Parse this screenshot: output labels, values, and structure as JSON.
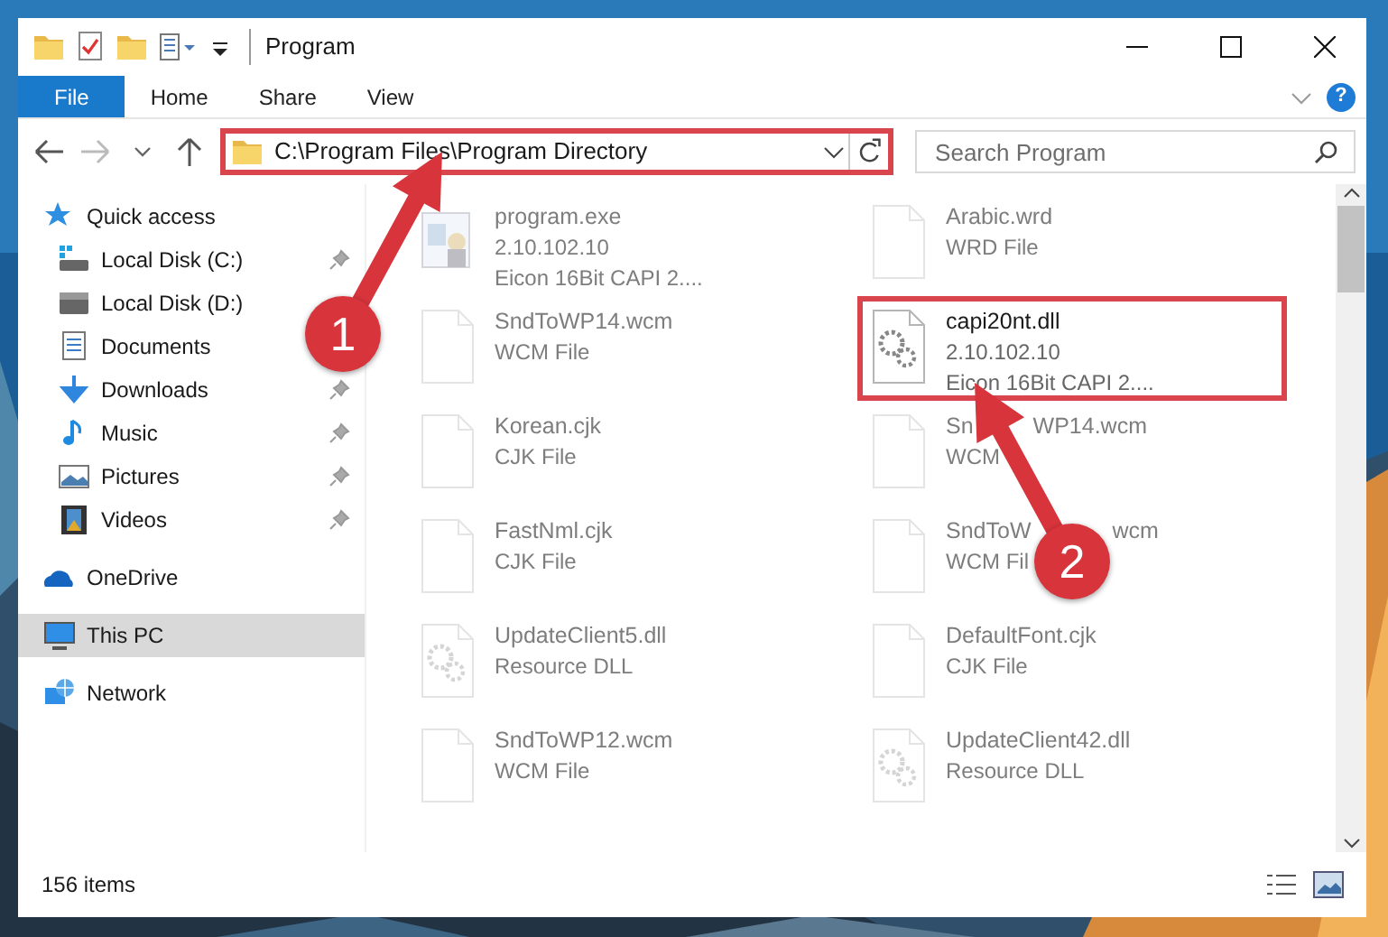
{
  "window": {
    "title": "Program"
  },
  "ribbon": {
    "tabs": [
      {
        "label": "File",
        "selected": true
      },
      {
        "label": "Home",
        "selected": false
      },
      {
        "label": "Share",
        "selected": false
      },
      {
        "label": "View",
        "selected": false
      }
    ],
    "help": "?"
  },
  "address_bar": {
    "path": "C:\\Program Files\\Program Directory",
    "highlighted": true
  },
  "search": {
    "placeholder": "Search Program"
  },
  "sidebar": {
    "items": [
      {
        "label": "Quick access",
        "selected": false,
        "children": [
          {
            "label": "Local Disk (C:)",
            "pinned": true,
            "selected": false
          },
          {
            "label": "Local Disk (D:)",
            "pinned": false,
            "selected": false
          },
          {
            "label": "Documents",
            "pinned": false,
            "selected": false
          },
          {
            "label": "Downloads",
            "pinned": true,
            "selected": false
          },
          {
            "label": "Music",
            "pinned": true,
            "selected": false
          },
          {
            "label": "Pictures",
            "pinned": true,
            "selected": false
          },
          {
            "label": "Videos",
            "pinned": true,
            "selected": false
          }
        ]
      },
      {
        "label": "OneDrive",
        "selected": false
      },
      {
        "label": "This PC",
        "selected": true
      },
      {
        "label": "Network",
        "selected": false
      }
    ]
  },
  "files": [
    {
      "name": "program.exe",
      "details": [
        "2.10.102.10",
        "Eicon 16Bit CAPI 2...."
      ],
      "kind": "program",
      "faded": true,
      "highlighted": false
    },
    {
      "name": "Arabic.wrd",
      "details": [
        "WRD File"
      ],
      "kind": "document",
      "faded": true,
      "highlighted": false
    },
    {
      "name": "SndToWP14.wcm",
      "details": [
        "WCM File"
      ],
      "kind": "document",
      "faded": true,
      "highlighted": false
    },
    {
      "name": "capi20nt.dll",
      "details": [
        "2.10.102.10",
        "Eicon 16Bit CAPI 2...."
      ],
      "kind": "settings",
      "faded": false,
      "highlighted": true
    },
    {
      "name": "Korean.cjk",
      "details": [
        "CJK File"
      ],
      "kind": "document",
      "faded": true,
      "highlighted": false
    },
    {
      "name": "Sn",
      "name_tail": "WP14.wcm",
      "details": [
        "WCM"
      ],
      "kind": "document",
      "faded": true,
      "highlighted": false
    },
    {
      "name": "FastNml.cjk",
      "details": [
        "CJK File"
      ],
      "kind": "document",
      "faded": true,
      "highlighted": false
    },
    {
      "name": "SndToW",
      "name_tail": "wcm",
      "details": [
        "WCM Fil"
      ],
      "kind": "document",
      "faded": true,
      "highlighted": false
    },
    {
      "name": "UpdateClient5.dll",
      "details": [
        "Resource DLL"
      ],
      "kind": "settings",
      "faded": true,
      "highlighted": false
    },
    {
      "name": "DefaultFont.cjk",
      "details": [
        "CJK File"
      ],
      "kind": "document",
      "faded": true,
      "highlighted": false
    },
    {
      "name": "SndToWP12.wcm",
      "details": [
        "WCM File"
      ],
      "kind": "document",
      "faded": true,
      "highlighted": false
    },
    {
      "name": "UpdateClient42.dll",
      "details": [
        "Resource DLL"
      ],
      "kind": "settings",
      "faded": true,
      "highlighted": false
    }
  ],
  "callouts": [
    {
      "label": "1"
    },
    {
      "label": "2"
    }
  ],
  "status_bar": {
    "count": "156 items"
  }
}
